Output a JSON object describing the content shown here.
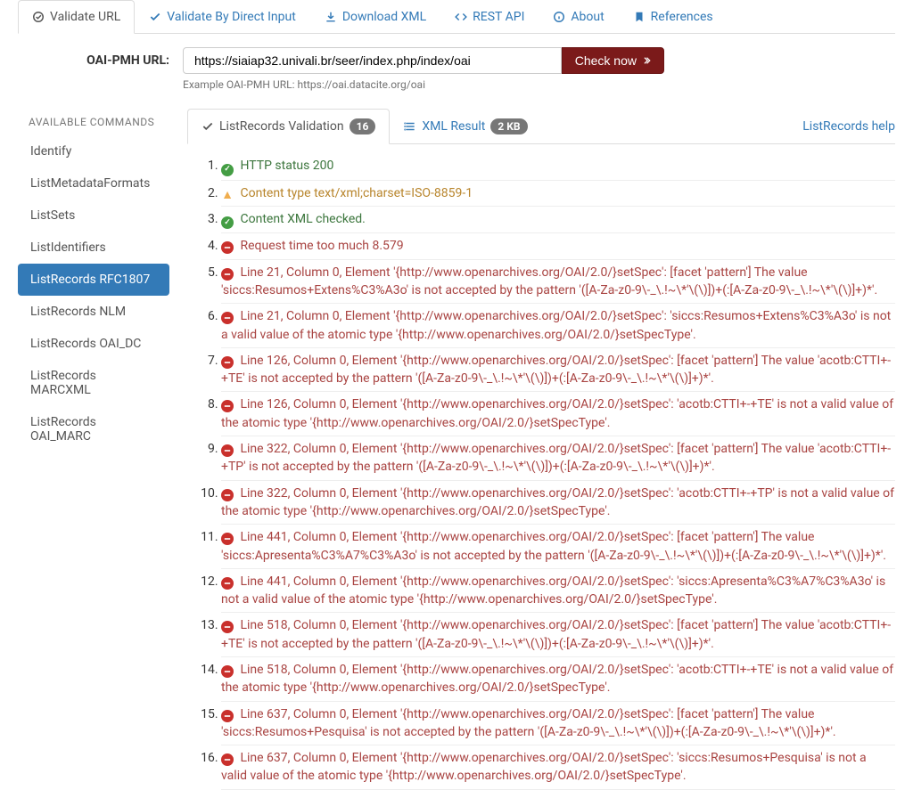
{
  "topTabs": {
    "validateUrl": "Validate URL",
    "validateDirect": "Validate By Direct Input",
    "downloadXml": "Download XML",
    "restApi": "REST API",
    "about": "About",
    "references": "References"
  },
  "form": {
    "label": "OAI-PMH URL:",
    "value": "https://siaiap32.univali.br/seer/index.php/index/oai",
    "button": "Check now",
    "help": "Example OAI-PMH URL: https://oai.datacite.org/oai"
  },
  "sidebar": {
    "title": "AVAILABLE COMMANDS",
    "items": [
      {
        "label": "Identify"
      },
      {
        "label": "ListMetadataFormats"
      },
      {
        "label": "ListSets"
      },
      {
        "label": "ListIdentifiers"
      },
      {
        "label": "ListRecords RFC1807",
        "active": true
      },
      {
        "label": "ListRecords NLM"
      },
      {
        "label": "ListRecords OAI_DC"
      },
      {
        "label": "ListRecords MARCXML"
      },
      {
        "label": "ListRecords OAI_MARC"
      }
    ]
  },
  "subTabs": {
    "validation": {
      "label": "ListRecords Validation",
      "badge": "16"
    },
    "xml": {
      "label": "XML Result",
      "badge": "2 KB"
    },
    "help": "ListRecords help"
  },
  "results": [
    {
      "type": "ok",
      "text": "HTTP status 200"
    },
    {
      "type": "warn",
      "text": "Content type text/xml;charset=ISO-8859-1"
    },
    {
      "type": "ok",
      "text": "Content XML checked."
    },
    {
      "type": "err",
      "text": "Request time too much 8.579"
    },
    {
      "type": "err",
      "text": "Line 21, Column 0, Element '{http://www.openarchives.org/OAI/2.0/}setSpec': [facet 'pattern'] The value 'siccs:Resumos+Extens%C3%A3o' is not accepted by the pattern '([A-Za-z0-9\\-_\\.!~\\*'\\(\\)])+(:[A-Za-z0-9\\-_\\.!~\\*'\\(\\)]+)*'."
    },
    {
      "type": "err",
      "text": "Line 21, Column 0, Element '{http://www.openarchives.org/OAI/2.0/}setSpec': 'siccs:Resumos+Extens%C3%A3o' is not a valid value of the atomic type '{http://www.openarchives.org/OAI/2.0/}setSpecType'."
    },
    {
      "type": "err",
      "text": "Line 126, Column 0, Element '{http://www.openarchives.org/OAI/2.0/}setSpec': [facet 'pattern'] The value 'acotb:CTTI+-+TE' is not accepted by the pattern '([A-Za-z0-9\\-_\\.!~\\*'\\(\\)])+(:[A-Za-z0-9\\-_\\.!~\\*'\\(\\)]+)*'."
    },
    {
      "type": "err",
      "text": "Line 126, Column 0, Element '{http://www.openarchives.org/OAI/2.0/}setSpec': 'acotb:CTTI+-+TE' is not a valid value of the atomic type '{http://www.openarchives.org/OAI/2.0/}setSpecType'."
    },
    {
      "type": "err",
      "text": "Line 322, Column 0, Element '{http://www.openarchives.org/OAI/2.0/}setSpec': [facet 'pattern'] The value 'acotb:CTTI+-+TP' is not accepted by the pattern '([A-Za-z0-9\\-_\\.!~\\*'\\(\\)])+(:[A-Za-z0-9\\-_\\.!~\\*'\\(\\)]+)*'."
    },
    {
      "type": "err",
      "text": "Line 322, Column 0, Element '{http://www.openarchives.org/OAI/2.0/}setSpec': 'acotb:CTTI+-+TP' is not a valid value of the atomic type '{http://www.openarchives.org/OAI/2.0/}setSpecType'."
    },
    {
      "type": "err",
      "text": "Line 441, Column 0, Element '{http://www.openarchives.org/OAI/2.0/}setSpec': [facet 'pattern'] The value 'siccs:Apresenta%C3%A7%C3%A3o' is not accepted by the pattern '([A-Za-z0-9\\-_\\.!~\\*'\\(\\)])+(:[A-Za-z0-9\\-_\\.!~\\*'\\(\\)]+)*'."
    },
    {
      "type": "err",
      "text": "Line 441, Column 0, Element '{http://www.openarchives.org/OAI/2.0/}setSpec': 'siccs:Apresenta%C3%A7%C3%A3o' is not a valid value of the atomic type '{http://www.openarchives.org/OAI/2.0/}setSpecType'."
    },
    {
      "type": "err",
      "text": "Line 518, Column 0, Element '{http://www.openarchives.org/OAI/2.0/}setSpec': [facet 'pattern'] The value 'acotb:CTTI+-+TE' is not accepted by the pattern '([A-Za-z0-9\\-_\\.!~\\*'\\(\\)])+(:[A-Za-z0-9\\-_\\.!~\\*'\\(\\)]+)*'."
    },
    {
      "type": "err",
      "text": "Line 518, Column 0, Element '{http://www.openarchives.org/OAI/2.0/}setSpec': 'acotb:CTTI+-+TE' is not a valid value of the atomic type '{http://www.openarchives.org/OAI/2.0/}setSpecType'."
    },
    {
      "type": "err",
      "text": "Line 637, Column 0, Element '{http://www.openarchives.org/OAI/2.0/}setSpec': [facet 'pattern'] The value 'siccs:Resumos+Pesquisa' is not accepted by the pattern '([A-Za-z0-9\\-_\\.!~\\*'\\(\\)])+(:[A-Za-z0-9\\-_\\.!~\\*'\\(\\)]+)*'."
    },
    {
      "type": "err",
      "text": "Line 637, Column 0, Element '{http://www.openarchives.org/OAI/2.0/}setSpec': 'siccs:Resumos+Pesquisa' is not a valid value of the atomic type '{http://www.openarchives.org/OAI/2.0/}setSpecType'."
    }
  ]
}
